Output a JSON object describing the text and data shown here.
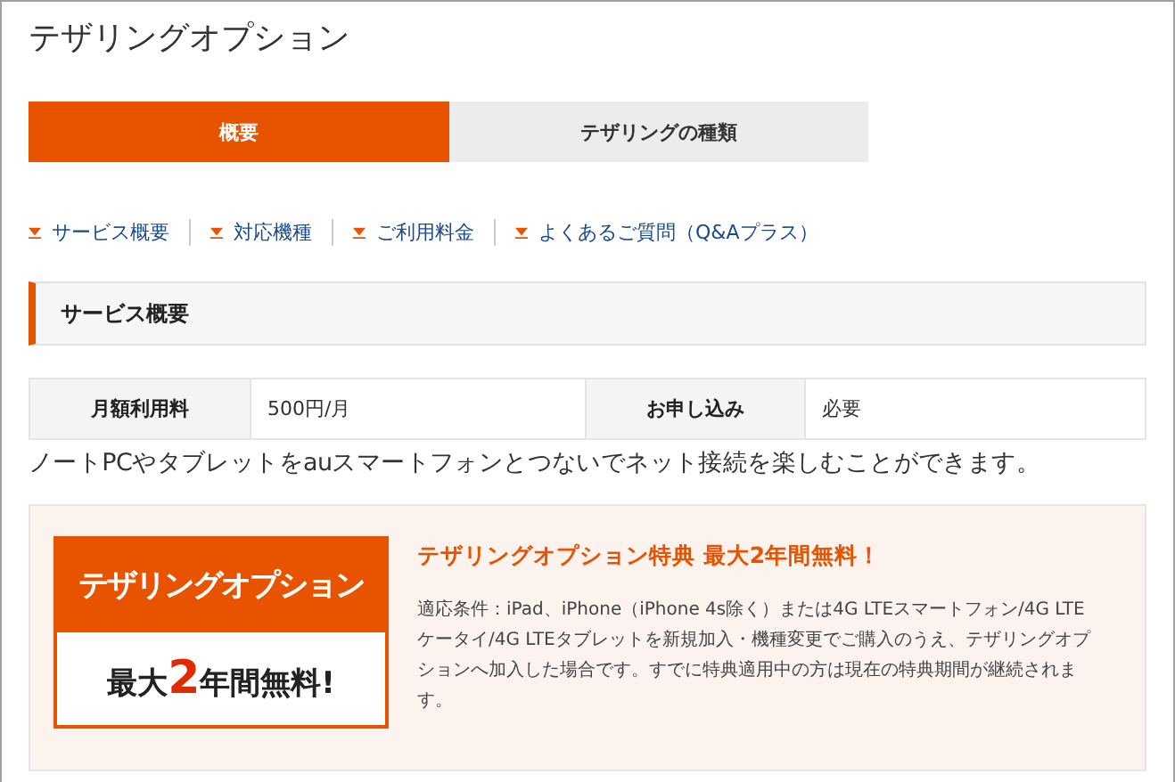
{
  "page_title": "テザリングオプション",
  "tabs": [
    {
      "label": "概要",
      "selected": true
    },
    {
      "label": "テザリングの種類",
      "selected": false
    }
  ],
  "anchor_links": [
    "サービス概要",
    "対応機種",
    "ご利用料金",
    "よくあるご質問（Q&Aプラス）"
  ],
  "section": {
    "heading": "サービス概要",
    "table": [
      {
        "label": "月額利用料",
        "value": "500円/月"
      },
      {
        "label": "お申し込み",
        "value": "必要"
      }
    ],
    "description": "ノートPCやタブレットをauスマートフォンとつないでネット接続を楽しむことができます。"
  },
  "promo": {
    "banner_title": "テザリングオプション",
    "banner_offer": "最大**2**年間無料!",
    "heading": "テザリングオプション特典 最大2年間無料！",
    "body": "適応条件：iPad、iPhone（iPhone 4s除く）または4G LTEスマートフォン/4G LTEケータイ/4G LTEタブレットを新規加入・機種変更でご購入のうえ、テザリングオプションへ加入した場合です。すでに特典適用中の方は現在の特典期間が継続されます。"
  }
}
